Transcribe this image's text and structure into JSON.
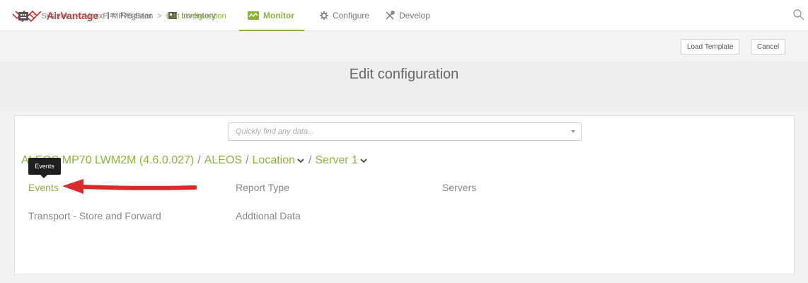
{
  "app": {
    "brand": "AirVantage",
    "brand_color": "#d12e2e",
    "accent_color": "#8ab53a"
  },
  "nav": {
    "items": [
      {
        "label": "Register",
        "icon": "register-icon"
      },
      {
        "label": "Inventory",
        "icon": "inventory-icon"
      },
      {
        "label": "Monitor",
        "icon": "monitor-icon",
        "active": true
      },
      {
        "label": "Configure",
        "icon": "gear-icon"
      },
      {
        "label": "Develop",
        "icon": "tools-icon"
      }
    ],
    "search_icon": "search-icon"
  },
  "breadcrumb": {
    "items": [
      "Systems",
      "MaxxFi-MP70-Sean"
    ],
    "current": "Edit configuration"
  },
  "toolbar": {
    "load_template_label": "Load Template",
    "cancel_label": "Cancel"
  },
  "page": {
    "title": "Edit configuration"
  },
  "panel": {
    "search_placeholder": "Quickly find any data...",
    "path": {
      "root": "ALEOS MP70 LWM2M (4.6.0.027)",
      "seg1": "ALEOS",
      "seg2": "Location",
      "seg3": "Server 1"
    },
    "tooltip": "Events",
    "items": {
      "events": "Events",
      "report_type": "Report Type",
      "servers": "Servers",
      "transport": "Transport - Store and Forward",
      "additional_data": "Addtional Data"
    }
  }
}
